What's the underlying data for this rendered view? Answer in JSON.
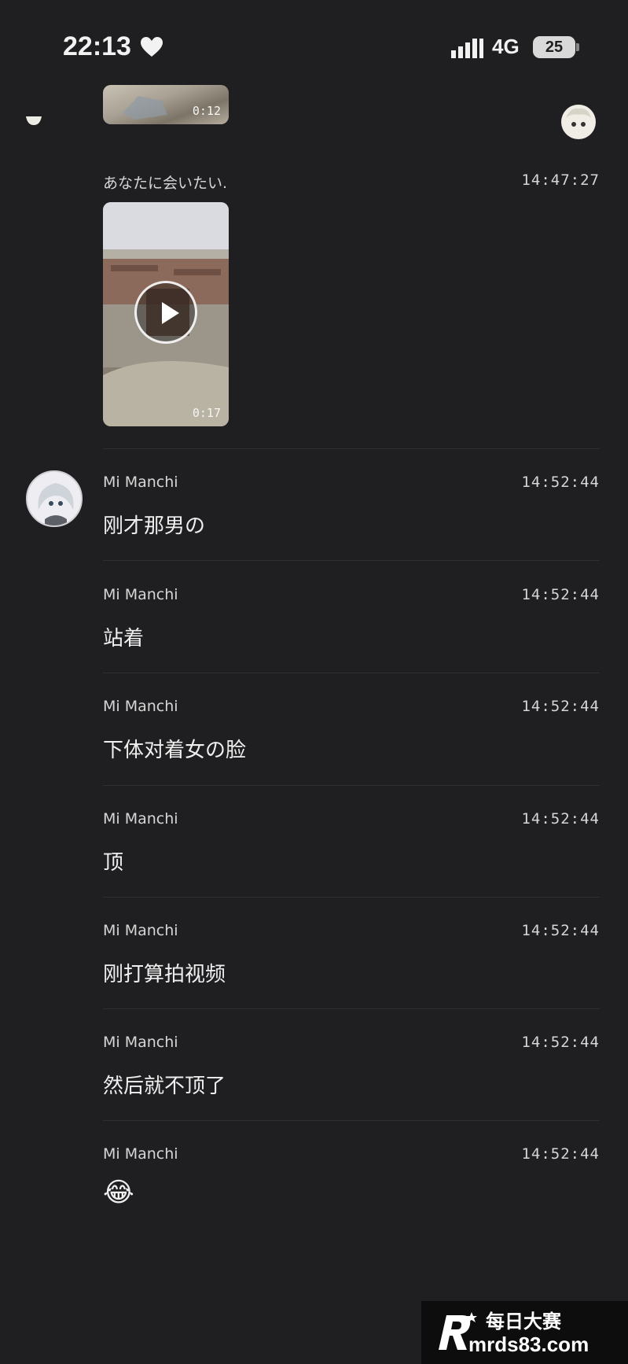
{
  "status_bar": {
    "time": "22:13",
    "network": "4G",
    "battery": "25"
  },
  "media": [
    {
      "caption": "",
      "duration": "0:12",
      "icon": "video"
    },
    {
      "caption": "あなたに会いたい.",
      "caption_time": "14:47:27",
      "duration": "0:17",
      "icon": "play-icon"
    }
  ],
  "messages": [
    {
      "name": "Mi Manchi",
      "time": "14:52:44",
      "text": "刚才那男の"
    },
    {
      "name": "Mi Manchi",
      "time": "14:52:44",
      "text": "站着"
    },
    {
      "name": "Mi Manchi",
      "time": "14:52:44",
      "text": "下体对着女の脸"
    },
    {
      "name": "Mi Manchi",
      "time": "14:52:44",
      "text": "顶"
    },
    {
      "name": "Mi Manchi",
      "time": "14:52:44",
      "text": "刚打算拍视频"
    },
    {
      "name": "Mi Manchi",
      "time": "14:52:44",
      "text": "然后就不顶了"
    },
    {
      "name": "Mi Manchi",
      "time": "14:52:44",
      "text": "😂"
    }
  ],
  "watermark": {
    "title": "每日大赛",
    "url": "mrds83.com"
  },
  "colors": {
    "background": "#1f1f21",
    "text": "#efefef",
    "muted": "#d6d6d6"
  }
}
